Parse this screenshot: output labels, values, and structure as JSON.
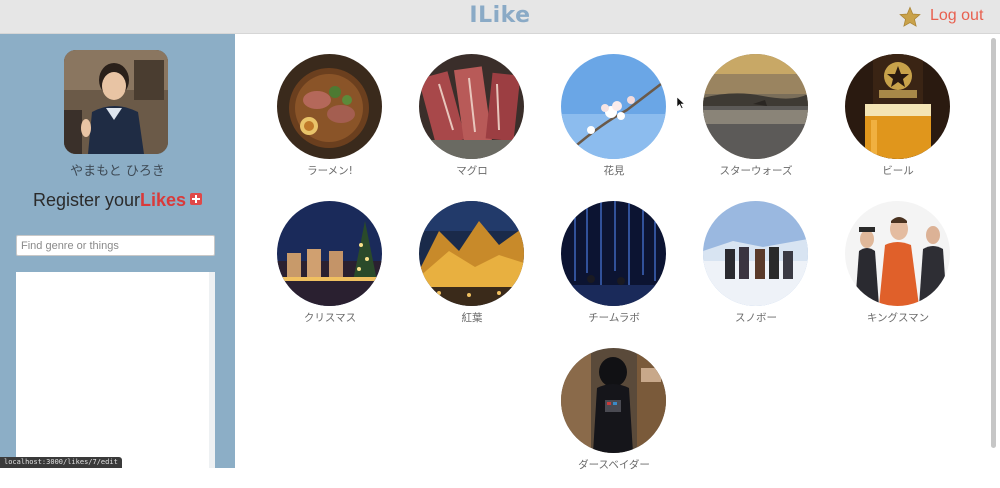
{
  "header": {
    "title": "ILike",
    "logout_label": "Log out",
    "star_icon": "star-icon"
  },
  "sidebar": {
    "user_name": "やまもと ひろき",
    "register_prefix": "Register your",
    "register_highlight": "Likes",
    "search_placeholder": "Find genre or things",
    "search_value": ""
  },
  "status_bar": {
    "url": "localhost:3000/likes/7/edit"
  },
  "likes": [
    {
      "label": "ラーメン!"
    },
    {
      "label": "マグロ"
    },
    {
      "label": "花見"
    },
    {
      "label": "スターウォーズ"
    },
    {
      "label": "ビール"
    },
    {
      "label": "クリスマス"
    },
    {
      "label": "紅葉"
    },
    {
      "label": "チームラボ"
    },
    {
      "label": "スノボー"
    },
    {
      "label": "キングスマン"
    },
    {
      "label": "ダースベイダー"
    }
  ],
  "colors": {
    "brand": "#8aaac6",
    "sidebar": "#8caec6",
    "logout": "#e8604f",
    "likes_highlight": "#d93a3a"
  }
}
